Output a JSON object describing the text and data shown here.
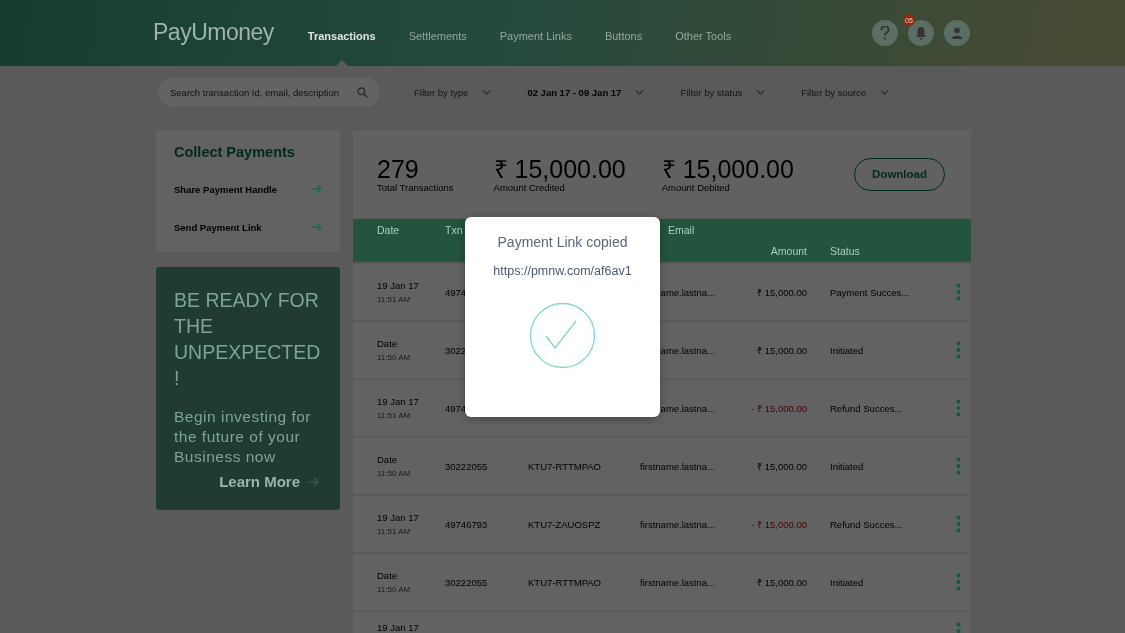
{
  "header": {
    "logo": "PayUmoney",
    "nav": [
      {
        "label": "Transactions",
        "selected": true
      },
      {
        "label": "Settlements",
        "selected": false
      },
      {
        "label": "Payment Links",
        "selected": false
      },
      {
        "label": "Buttons",
        "selected": false
      },
      {
        "label": "Other Tools",
        "selected": false
      }
    ],
    "notification_count": "05"
  },
  "filters": {
    "search": {
      "placeholder": "Search transaction Id, email, description"
    },
    "dropdowns": [
      {
        "label": "Filter by type",
        "kind": "placeholder"
      },
      {
        "label": "02 Jan 17 - 09 Jan 17",
        "kind": "value"
      },
      {
        "label": "Filter by status",
        "kind": "placeholder"
      },
      {
        "label": "Filter by source",
        "kind": "placeholder"
      }
    ]
  },
  "collect_payments": {
    "title": "Collect Payments",
    "items": [
      "Share Payment Handle",
      "Send Payment Link"
    ]
  },
  "promo": {
    "heading": "BE READY FOR THE UNPEXPECTED !",
    "body": "Begin investing for the future of your Business now",
    "link": "Learn More"
  },
  "stats": [
    {
      "value": "279",
      "label": "Total Transactions"
    },
    {
      "value": "₹ 15,000.00",
      "label": "Amount Credited"
    },
    {
      "value": "₹ 15,000.00",
      "label": "Amount Debited"
    }
  ],
  "download_button": "Download",
  "table": {
    "columns": [
      "Date",
      "Txn",
      "Email",
      "Amount",
      "Status"
    ],
    "rows": [
      {
        "date": "19 Jan 17",
        "time": "11:51 AM",
        "txn": "4974",
        "email": "ame.lastna...",
        "amount": "₹ 15,000.00",
        "debit": false,
        "status": "Payment Succes..."
      },
      {
        "date": "Date",
        "time": "11:50 AM",
        "txn": "3022",
        "email": "ame.lastna...",
        "amount": "₹ 15,000.00",
        "debit": false,
        "status": "Initiated"
      },
      {
        "date": "19 Jan 17",
        "time": "11:51 AM",
        "txn": "4974",
        "email": "ame.lastna...",
        "amount": "- ₹ 15,000.00",
        "debit": true,
        "status": "Refund Succes..."
      },
      {
        "date": "Date",
        "time": "11:50 AM",
        "txn": "30222055",
        "order": "KTU7-RTTMPAO",
        "email": "firstname.lastna...",
        "amount": "₹ 15,000.00",
        "debit": false,
        "status": "Initiated"
      },
      {
        "date": "19 Jan 17",
        "time": "11:51 AM",
        "txn": "49746793",
        "order": "KTU7-ZAUOSPZ",
        "email": "firstname.lastna...",
        "amount": "- ₹ 15,000.00",
        "debit": true,
        "status": "Refund Succes..."
      },
      {
        "date": "Date",
        "time": "11:50 AM",
        "txn": "30222055",
        "order": "KTU7-RTTMPAO",
        "email": "firstname.lastna...",
        "amount": "₹ 15,000.00",
        "debit": false,
        "status": "Initiated"
      },
      {
        "date": "19 Jan 17"
      }
    ]
  },
  "modal": {
    "title": "Payment Link copied",
    "link": "https://pmnw.com/af6av1"
  }
}
